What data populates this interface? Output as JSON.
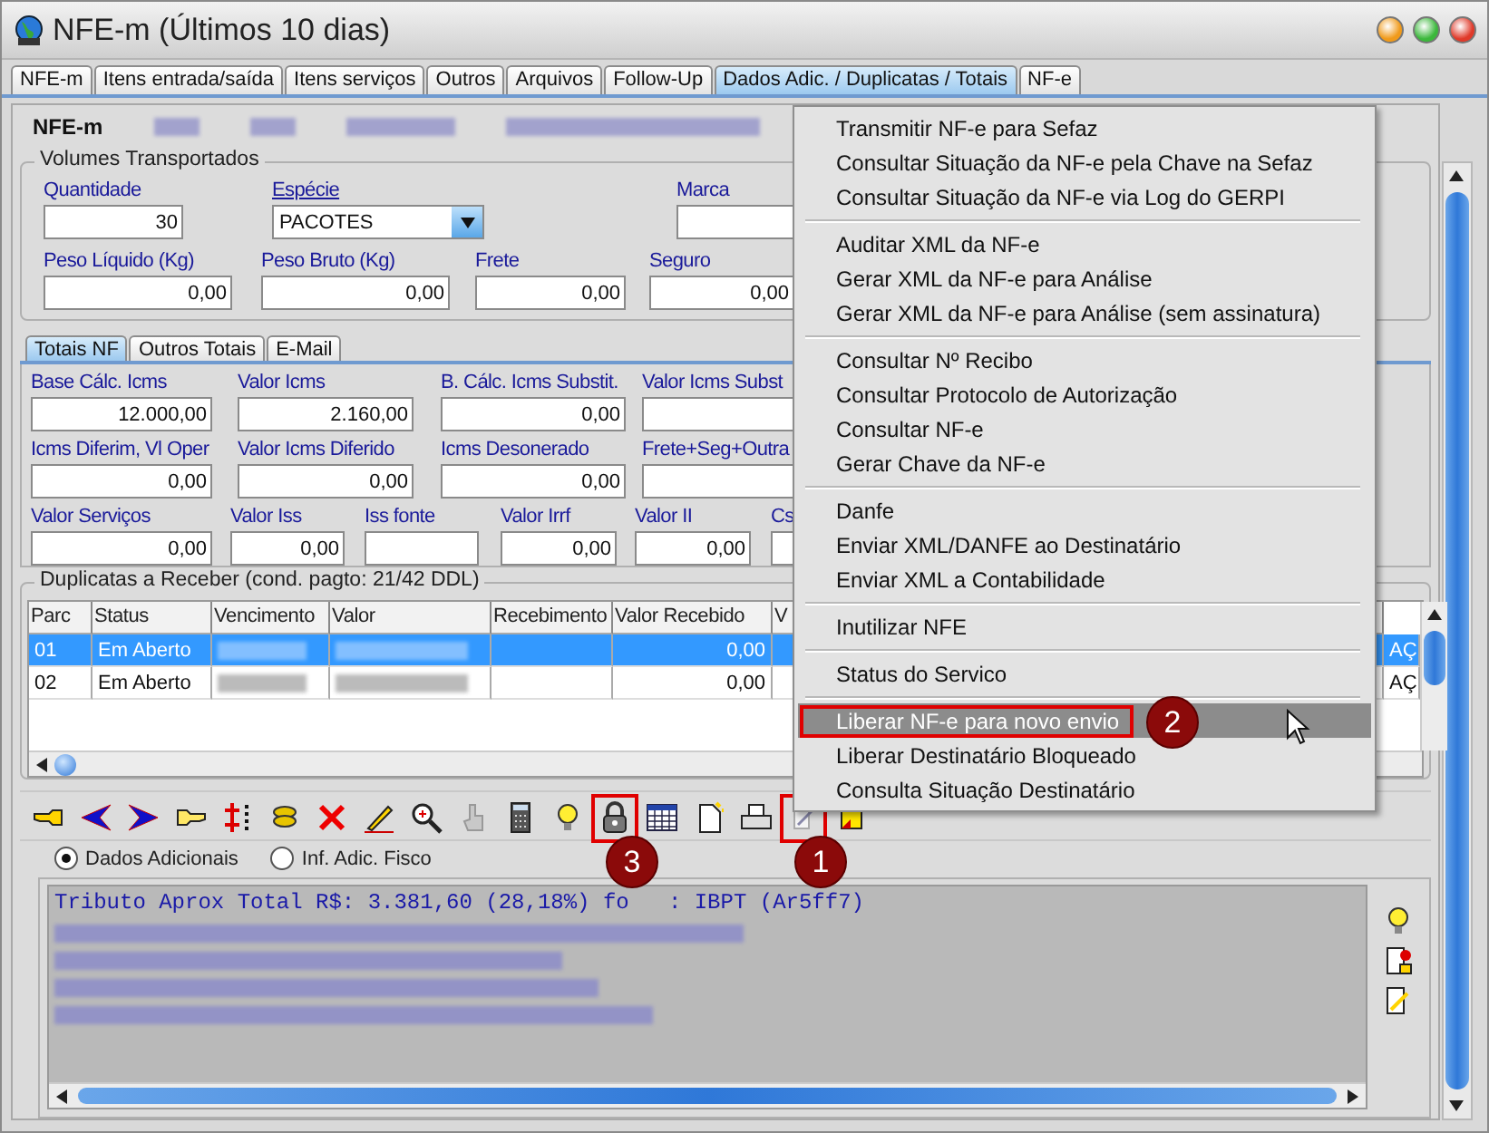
{
  "window": {
    "title": "NFE-m (Últimos 10 dias)"
  },
  "tabs": [
    {
      "label": "NFE-m",
      "selected": false
    },
    {
      "label": "Itens entrada/saída",
      "selected": false
    },
    {
      "label": "Itens serviços",
      "selected": false
    },
    {
      "label": "Outros",
      "selected": false
    },
    {
      "label": "Arquivos",
      "selected": false
    },
    {
      "label": "Follow-Up",
      "selected": false
    },
    {
      "label": "Dados Adic. / Duplicatas / Totais",
      "selected": true
    },
    {
      "label": "NF-e",
      "selected": false
    }
  ],
  "header": {
    "label": "NFE-m"
  },
  "volumes": {
    "title": "Volumes Transportados",
    "fields": [
      {
        "label": "Quantidade",
        "value": "30",
        "kind": "text"
      },
      {
        "label": "Espécie",
        "value": "PACOTES",
        "kind": "combo"
      },
      {
        "label": "Marca",
        "kind": "text"
      },
      {
        "label": "Peso Líquido (Kg)",
        "value": "0,00",
        "kind": "text"
      },
      {
        "label": "Peso Bruto (Kg)",
        "value": "0,00",
        "kind": "text"
      },
      {
        "label": "Frete",
        "value": "0,00",
        "kind": "text"
      },
      {
        "label": "Seguro",
        "value": "0,00",
        "kind": "text"
      }
    ]
  },
  "totals_tabs": [
    {
      "label": "Totais NF",
      "selected": true
    },
    {
      "label": "Outros Totais",
      "selected": false
    },
    {
      "label": "E-Mail",
      "selected": false
    }
  ],
  "totals": {
    "fields": [
      {
        "label": "Base Cálc. Icms",
        "value": "12.000,00"
      },
      {
        "label": "Valor Icms",
        "value": "2.160,00"
      },
      {
        "label": "B. Cálc. Icms Substit.",
        "value": "0,00"
      },
      {
        "label": "Valor Icms Subst"
      },
      {
        "label": "Icms Diferim, Vl Oper",
        "value": "0,00"
      },
      {
        "label": "Valor Icms Diferido",
        "value": "0,00"
      },
      {
        "label": "Icms Desonerado",
        "value": "0,00"
      },
      {
        "label": "Frete+Seg+Outra"
      },
      {
        "label": "Valor Serviços",
        "value": "0,00"
      },
      {
        "label": "Valor Iss",
        "value": "0,00"
      },
      {
        "label": "Iss fonte"
      },
      {
        "label": "Valor Irrf",
        "value": "0,00"
      },
      {
        "label": "Valor II",
        "value": "0,00"
      },
      {
        "label": "Cs"
      }
    ]
  },
  "installments": {
    "title": "Duplicatas a Receber (cond. pagto: 21/42 DDL)",
    "columns": [
      "Parc",
      "Status",
      "Vencimento",
      "Valor",
      "Recebimento",
      "Valor Recebido",
      "V"
    ],
    "rows": [
      {
        "selected": true,
        "cells": [
          {
            "kind": "text",
            "text": "01"
          },
          {
            "kind": "text",
            "text": "Em Aberto"
          },
          {
            "kind": "redacted"
          },
          {
            "kind": "redacted"
          },
          {
            "kind": "empty"
          },
          {
            "kind": "number",
            "text": "0,00"
          },
          {
            "kind": "empty"
          },
          {
            "kind": "text",
            "text": "AÇ"
          }
        ]
      },
      {
        "selected": false,
        "cells": [
          {
            "kind": "text",
            "text": "02"
          },
          {
            "kind": "text",
            "text": "Em Aberto"
          },
          {
            "kind": "redacted"
          },
          {
            "kind": "redacted"
          },
          {
            "kind": "empty"
          },
          {
            "kind": "number",
            "text": "0,00"
          },
          {
            "kind": "empty"
          },
          {
            "kind": "text",
            "text": "AÇ"
          }
        ]
      }
    ]
  },
  "tools": [
    {
      "kind": "pointer"
    },
    {
      "kind": "left"
    },
    {
      "kind": "right"
    },
    {
      "kind": "hand"
    },
    {
      "kind": "insert"
    },
    {
      "kind": "coins"
    },
    {
      "kind": "delete"
    },
    {
      "kind": "pen"
    },
    {
      "kind": "zoom"
    },
    {
      "kind": "greyhand"
    },
    {
      "kind": "calculator"
    },
    {
      "kind": "bulb"
    },
    {
      "kind": "lock",
      "framed": true,
      "callout": "3"
    },
    {
      "kind": "grid"
    },
    {
      "kind": "newdoc"
    },
    {
      "kind": "printer"
    },
    {
      "kind": "editdoc",
      "framed": true,
      "callout": "1"
    },
    {
      "kind": "note"
    }
  ],
  "notes": {
    "options": [
      {
        "label": "Dados Adicionais",
        "selected": true
      },
      {
        "label": "Inf. Adic. Fisco",
        "selected": false
      }
    ],
    "lines": [
      {
        "kind": "text",
        "segments": [
          "Tributo Aprox Total R$: 3.381,60 (28,18%) fo",
          ": IBPT (Ar5ff7)"
        ]
      },
      {
        "kind": "redacted"
      },
      {
        "kind": "redacted"
      },
      {
        "kind": "redacted"
      },
      {
        "kind": "redacted"
      }
    ]
  },
  "context_menu": {
    "groups": [
      [
        {
          "label": "Transmitir NF-e para Sefaz",
          "selected": false
        },
        {
          "label": "Consultar Situação da NF-e pela Chave na Sefaz",
          "selected": false
        },
        {
          "label": "Consultar Situação da NF-e via Log do GERPI",
          "selected": false
        }
      ],
      [
        {
          "label": "Auditar XML da NF-e",
          "selected": false
        },
        {
          "label": "Gerar XML da NF-e para Análise",
          "selected": false
        },
        {
          "label": "Gerar XML da NF-e para Análise (sem assinatura)",
          "selected": false
        }
      ],
      [
        {
          "label": "Consultar Nº Recibo",
          "selected": false
        },
        {
          "label": "Consultar Protocolo de Autorização",
          "selected": false
        },
        {
          "label": "Consultar NF-e",
          "selected": false
        },
        {
          "label": "Gerar Chave da NF-e",
          "selected": false
        }
      ],
      [
        {
          "label": "Danfe",
          "selected": false
        },
        {
          "label": "Enviar XML/DANFE ao Destinatário",
          "selected": false
        },
        {
          "label": "Enviar XML a Contabilidade",
          "selected": false
        }
      ],
      [
        {
          "label": "Inutilizar NFE",
          "selected": false
        }
      ],
      [
        {
          "label": "Status do Servico",
          "selected": false
        }
      ],
      [
        {
          "label": "Liberar NF-e para novo envio",
          "selected": true,
          "framed": true,
          "callout": "2"
        },
        {
          "label": "Liberar Destinatário Bloqueado",
          "selected": false
        },
        {
          "label": "Consulta Situação Destinatário",
          "selected": false
        }
      ]
    ]
  }
}
